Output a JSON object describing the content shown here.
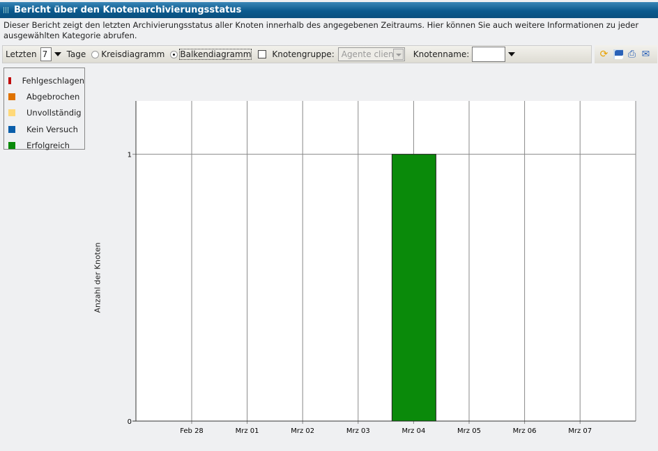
{
  "title": "Bericht über den Knotenarchivierungsstatus",
  "description": "Dieser Bericht zeigt den letzten Archivierungsstatus aller Knoten innerhalb des angegebenen Zeitraums. Hier können Sie auch weitere Informationen zu jeder ausgewählten Kategorie abrufen.",
  "toolbar": {
    "last_label": "Letzten",
    "days_value": "7",
    "days_label": "Tage",
    "pie_label": "Kreisdiagramm",
    "bar_label": "Balkendiagramm",
    "chart_type_selected": "bar",
    "group_checked": false,
    "group_label": "Knotengruppe:",
    "group_value": "Agente client",
    "name_label": "Knotenname:",
    "name_value": ""
  },
  "tools": [
    "refresh-icon",
    "save-icon",
    "print-icon",
    "email-icon"
  ],
  "legend": [
    {
      "label": "Fehlgeschlagen",
      "color": "#c00c0c"
    },
    {
      "label": "Abgebrochen",
      "color": "#df7200"
    },
    {
      "label": "Unvollständig",
      "color": "#ffd97a"
    },
    {
      "label": "Kein Versuch",
      "color": "#0a5eaa"
    },
    {
      "label": "Erfolgreich",
      "color": "#0a8a0a"
    }
  ],
  "chart_data": {
    "type": "bar",
    "ylabel": "Anzahl der Knoten",
    "categories": [
      "Feb 28",
      "Mrz 01",
      "Mrz 02",
      "Mrz 03",
      "Mrz 04",
      "Mrz 05",
      "Mrz 06",
      "Mrz 07"
    ],
    "series": [
      {
        "name": "Erfolgreich",
        "values": [
          0,
          0,
          0,
          0,
          1,
          0,
          0,
          0
        ],
        "color": "#0a8a0a"
      }
    ],
    "yticks": [
      0,
      1
    ],
    "ylim": [
      0,
      1.2
    ],
    "grid": true
  }
}
